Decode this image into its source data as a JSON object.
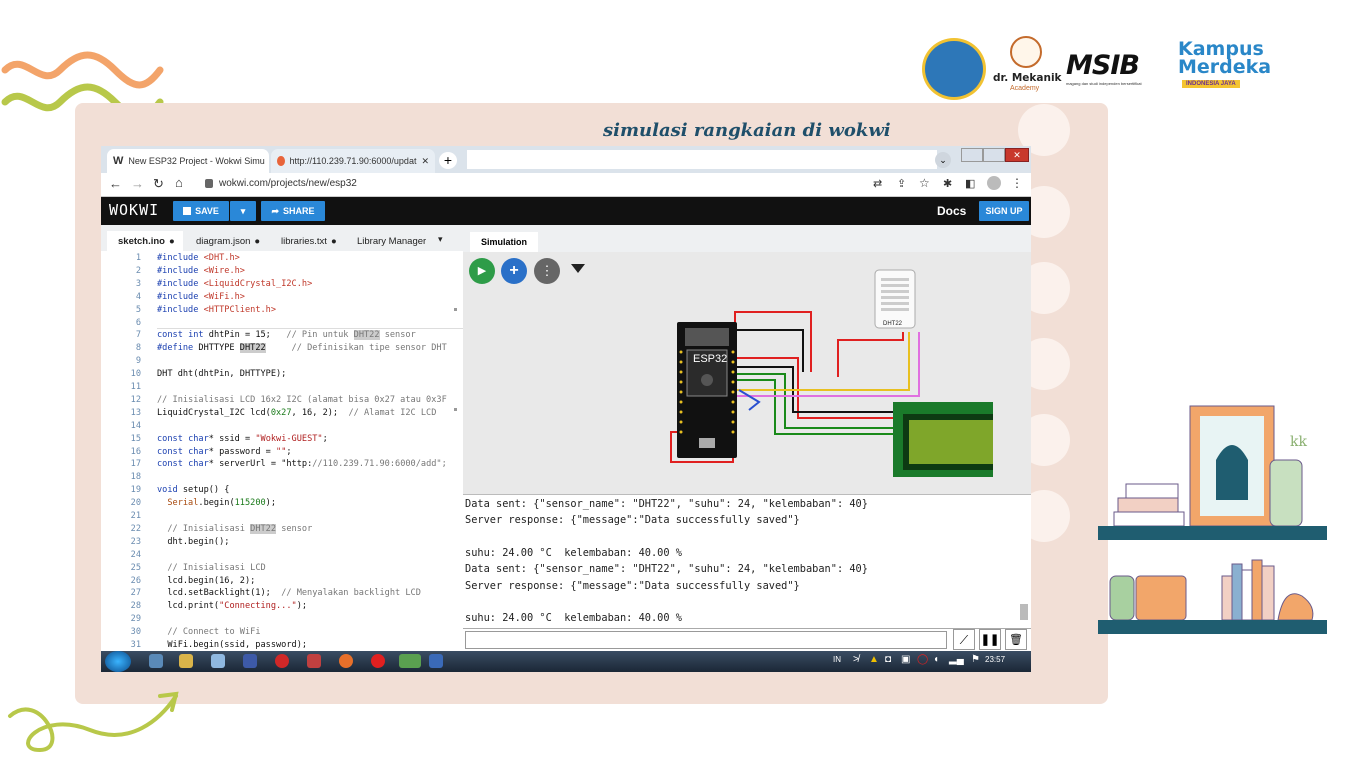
{
  "slide": {
    "title": "simulasi  rangkaian di wokwi",
    "logos": {
      "mekanik_name": "dr. Mekanik",
      "mekanik_sub": "Academy",
      "msib": "MSIB",
      "msib_sub": "magang dan studi independen bersertifikat",
      "kampus_1": "Kampus",
      "kampus_2": "Merdeka",
      "kampus_tag": "INDONESIA JAYA"
    }
  },
  "browser": {
    "tabs": [
      {
        "label": "New ESP32 Project - Wokwi Simu"
      },
      {
        "label": "http://110.239.71.90:6000/updat"
      }
    ],
    "url": "wokwi.com/projects/new/esp32"
  },
  "wokwi": {
    "logo": "WOKWI",
    "save": "SAVE",
    "share": "SHARE",
    "docs": "Docs",
    "signup": "SIGN UP",
    "editor_tabs": [
      "sketch.ino",
      "diagram.json",
      "libraries.txt",
      "Library Manager"
    ],
    "sim_tab": "Simulation",
    "esp_label": "ESP32",
    "dht_label": "DHT22"
  },
  "code": [
    {
      "n": "1",
      "t": "#include <DHT.h>"
    },
    {
      "n": "2",
      "t": "#include <Wire.h>"
    },
    {
      "n": "3",
      "t": "#include <LiquidCrystal_I2C.h>"
    },
    {
      "n": "4",
      "t": "#include <WiFi.h>"
    },
    {
      "n": "5",
      "t": "#include <HTTPClient.h>"
    },
    {
      "n": "6",
      "t": ""
    },
    {
      "n": "7",
      "t": "const int dhtPin = 15;   // Pin untuk DHT22 sensor"
    },
    {
      "n": "8",
      "t": "#define DHTTYPE DHT22     // Definisikan tipe sensor DHT"
    },
    {
      "n": "9",
      "t": ""
    },
    {
      "n": "10",
      "t": "DHT dht(dhtPin, DHTTYPE);"
    },
    {
      "n": "11",
      "t": ""
    },
    {
      "n": "12",
      "t": "// Inisialisasi LCD 16x2 I2C (alamat bisa 0x27 atau 0x3F"
    },
    {
      "n": "13",
      "t": "LiquidCrystal_I2C lcd(0x27, 16, 2);  // Alamat I2C LCD"
    },
    {
      "n": "14",
      "t": ""
    },
    {
      "n": "15",
      "t": "const char* ssid = \"Wokwi-GUEST\";"
    },
    {
      "n": "16",
      "t": "const char* password = \"\";"
    },
    {
      "n": "17",
      "t": "const char* serverUrl = \"http://110.239.71.90:6000/add\";"
    },
    {
      "n": "18",
      "t": ""
    },
    {
      "n": "19",
      "t": "void setup() {"
    },
    {
      "n": "20",
      "t": "  Serial.begin(115200);"
    },
    {
      "n": "21",
      "t": ""
    },
    {
      "n": "22",
      "t": "  // Inisialisasi DHT22 sensor"
    },
    {
      "n": "23",
      "t": "  dht.begin();"
    },
    {
      "n": "24",
      "t": ""
    },
    {
      "n": "25",
      "t": "  // Inisialisasi LCD"
    },
    {
      "n": "26",
      "t": "  lcd.begin(16, 2);"
    },
    {
      "n": "27",
      "t": "  lcd.setBacklight(1);  // Menyalakan backlight LCD"
    },
    {
      "n": "28",
      "t": "  lcd.print(\"Connecting...\");"
    },
    {
      "n": "29",
      "t": ""
    },
    {
      "n": "30",
      "t": "  // Connect to WiFi"
    },
    {
      "n": "31",
      "t": "  WiFi.begin(ssid, password);"
    }
  ],
  "serial": [
    "Data sent: {\"sensor_name\": \"DHT22\", \"suhu\": 24, \"kelembaban\": 40}",
    "Server response: {\"message\":\"Data successfully saved\"}",
    "",
    "suhu: 24.00 °C  kelembaban: 40.00 %",
    "Data sent: {\"sensor_name\": \"DHT22\", \"suhu\": 24, \"kelembaban\": 40}",
    "Server response: {\"message\":\"Data successfully saved\"}",
    "",
    "suhu: 24.00 °C  kelembaban: 40.00 %"
  ],
  "taskbar": {
    "lang": "IN",
    "time": "23:57"
  }
}
